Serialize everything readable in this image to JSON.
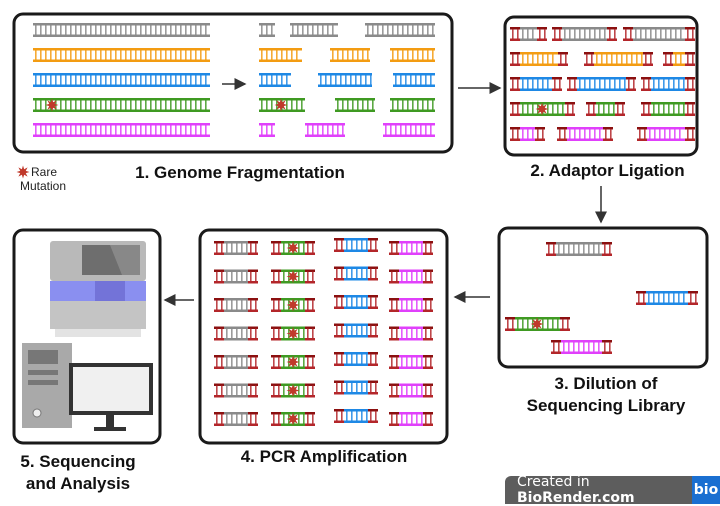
{
  "steps": {
    "s1": "1.  Genome Fragmentation",
    "s2": "2. Adaptor Ligation",
    "s3_line1": "3. Dilution of",
    "s3_line2": "Sequencing Library",
    "s4": "4. PCR Amplification",
    "s5_line1": "5. Sequencing",
    "s5_line2": "and Analysis"
  },
  "legend": {
    "line1": "Rare",
    "line2": "Mutation",
    "icon": "star-mutation-icon"
  },
  "badge": {
    "prefix": "Created in ",
    "brand": "BioRender.com",
    "logo": "bio"
  },
  "colors": {
    "gray": "#8a8a8a",
    "orange": "#f39c12",
    "blue": "#1e88e5",
    "green": "#3f9a22",
    "magenta": "#e040fb",
    "adaptor": "#b3262a",
    "mutation": "#c0392b"
  }
}
